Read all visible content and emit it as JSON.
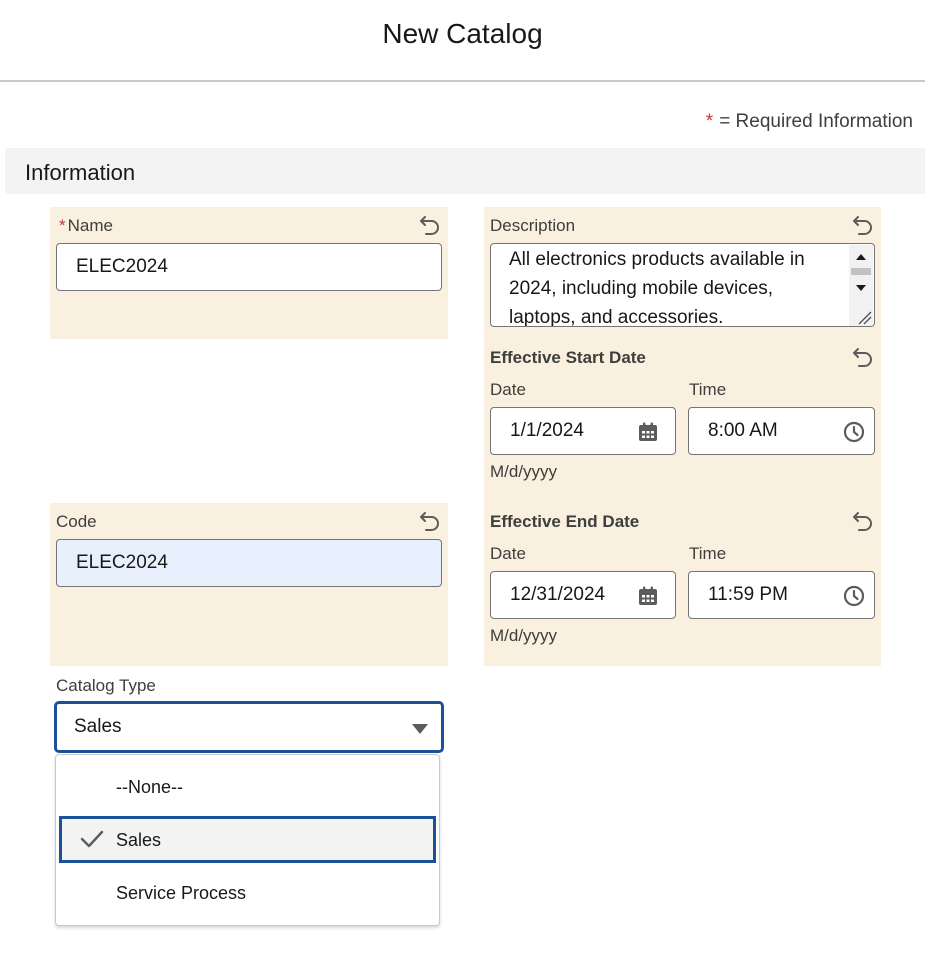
{
  "modal": {
    "title": "New Catalog"
  },
  "required_note": {
    "star": "*",
    "text": "= Required Information"
  },
  "section": {
    "title": "Information"
  },
  "name_field": {
    "star": "*",
    "label": "Name",
    "value": "ELEC2024"
  },
  "description_field": {
    "label": "Description",
    "value": "All electronics products available in 2024, including mobile devices, laptops, and accessories."
  },
  "start_date": {
    "label": "Effective Start Date",
    "date_label": "Date",
    "date_value": "1/1/2024",
    "date_format": "M/d/yyyy",
    "time_label": "Time",
    "time_value": "8:00 AM"
  },
  "code_field": {
    "label": "Code",
    "value": "ELEC2024"
  },
  "end_date": {
    "label": "Effective End Date",
    "date_label": "Date",
    "date_value": "12/31/2024",
    "date_format": "M/d/yyyy",
    "time_label": "Time",
    "time_value": "11:59 PM"
  },
  "catalog_type": {
    "label": "Catalog Type",
    "value": "Sales",
    "options": [
      "--None--",
      "Sales",
      "Service Process"
    ],
    "selected_index": 1
  },
  "colors": {
    "panel_highlight": "#faf0df",
    "focus_border": "#1b5297",
    "required_star": "#c23934",
    "autofill_background": "#e8f0fe"
  },
  "icons": {
    "undo": "undo-icon",
    "calendar": "calendar-icon",
    "clock": "clock-icon",
    "dropdown": "chevron-down-icon",
    "check": "check-icon"
  }
}
